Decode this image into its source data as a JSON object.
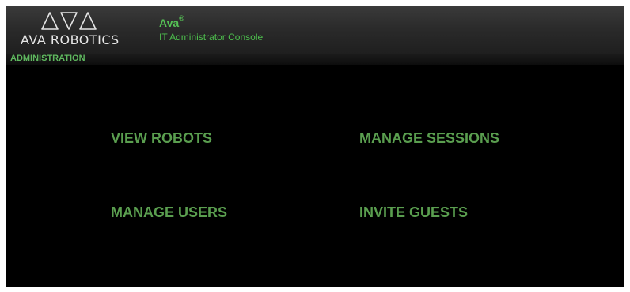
{
  "header": {
    "logo_text": "AVA ROBOTICS",
    "app_name": "Ava",
    "app_name_mark": "®",
    "app_subtitle": "IT Administrator Console"
  },
  "section": {
    "label": "ADMINISTRATION"
  },
  "actions": {
    "view_robots": "VIEW ROBOTS",
    "manage_sessions": "MANAGE SESSIONS",
    "manage_users": "MANAGE USERS",
    "invite_guests": "INVITE GUESTS"
  },
  "colors": {
    "accent_green": "#55c255",
    "link_green": "#5a9e4f",
    "background": "#000000",
    "header_gray": "#2b2b2b"
  },
  "icons": {
    "logo_mark": "ava-triangles-logo-icon"
  }
}
